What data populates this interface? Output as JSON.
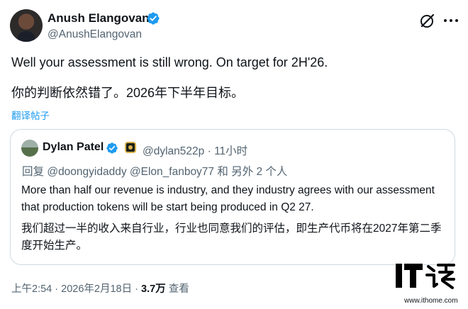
{
  "author": {
    "name": "Anush Elangovan",
    "handle": "@AnushElangovan"
  },
  "tweet": {
    "text_en": "Well your assessment is still wrong. On target for 2H'26.",
    "text_zh": "你的判断依然错了。2026年下半年目标。",
    "translate_label": "翻译帖子"
  },
  "quote": {
    "name": "Dylan Patel",
    "handle": "@dylan522p",
    "separator": "·",
    "time": "11小时",
    "reply_prefix": "回复",
    "reply_to": "@doongyidaddy @Elon_fanboy77 和 另外 2 个人",
    "text_en": "More than half our revenue is industry, and they industry agrees with our assessment that production tokens will be start being produced in Q2 27.",
    "text_zh": "我们超过一半的收入来自行业，行业也同意我们的评估，即生产代币将在2027年第二季度开始生产。"
  },
  "footer": {
    "time": "上午2:54",
    "date": "2026年2月18日",
    "views": "3.7万",
    "views_label": "查看"
  },
  "watermark": {
    "logo_text": "IT之家",
    "url": "www.ithome.com"
  },
  "colors": {
    "accent": "#1d9bf0",
    "secondary_text": "#536471",
    "border": "#cfd9de"
  }
}
